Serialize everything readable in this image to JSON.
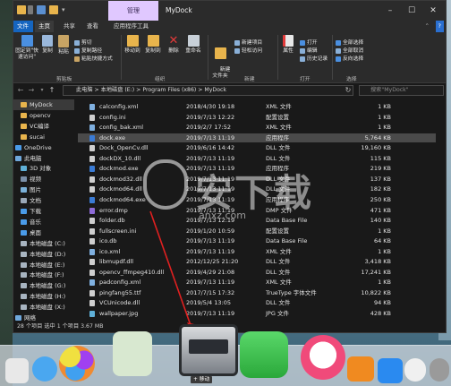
{
  "window": {
    "title": "MyDock",
    "context_tab": "管理",
    "controls": {
      "minimize": "–",
      "maximize": "☐",
      "close": "✕"
    }
  },
  "ribbon_tabs": [
    "文件",
    "主页",
    "共享",
    "查看",
    "应用程序工具"
  ],
  "ribbon": {
    "clipboard": {
      "pin": "固定到\"快速访问\"",
      "copy": "复制",
      "paste": "粘贴",
      "cut": "剪切",
      "copy_path": "复制路径",
      "paste_shortcut": "粘贴快捷方式",
      "label": "剪贴板"
    },
    "organize": {
      "move_to": "移动到",
      "copy_to": "复制到",
      "delete": "删除",
      "rename": "重命名",
      "label": "组织"
    },
    "new": {
      "new_folder": "新建\n文件夹",
      "new_item": "新建项目",
      "easy_access": "轻松访问",
      "label": "新建"
    },
    "open": {
      "properties": "属性",
      "open": "打开",
      "edit": "编辑",
      "history": "历史记录",
      "label": "打开"
    },
    "select": {
      "select_all": "全部选择",
      "select_none": "全部取消",
      "invert": "反向选择",
      "label": "选择"
    }
  },
  "address": {
    "path": "此电脑  >  本地磁盘 (E:)  >  Program Files (x86)  >  MyDock",
    "search_placeholder": "搜索\"MyDock\""
  },
  "nav_pane": [
    {
      "label": "MyDock",
      "color": "#e8b44c"
    },
    {
      "label": "opencv",
      "color": "#e8b44c"
    },
    {
      "label": "VC编译",
      "color": "#e8b44c"
    },
    {
      "label": "sucai",
      "color": "#e8b44c"
    },
    {
      "label": "OneDrive",
      "color": "#4a9be8"
    },
    {
      "label": "此电脑",
      "color": "#6fa8dc"
    },
    {
      "label": "3D 对象",
      "color": "#5fb0d8"
    },
    {
      "label": "视频",
      "color": "#7a8fa8"
    },
    {
      "label": "图片",
      "color": "#7ab0d8"
    },
    {
      "label": "文档",
      "color": "#9aa8b8"
    },
    {
      "label": "下载",
      "color": "#4a9be8"
    },
    {
      "label": "音乐",
      "color": "#4a9be8"
    },
    {
      "label": "桌面",
      "color": "#4a9be8"
    },
    {
      "label": "本地磁盘 (C:)",
      "color": "#a8b4c0"
    },
    {
      "label": "本地磁盘 (D:)",
      "color": "#a8b4c0"
    },
    {
      "label": "本地磁盘 (E:)",
      "color": "#a8b4c0"
    },
    {
      "label": "本地磁盘 (F:)",
      "color": "#a8b4c0"
    },
    {
      "label": "本地磁盘 (G:)",
      "color": "#a8b4c0"
    },
    {
      "label": "本地磁盘 (H:)",
      "color": "#a8b4c0"
    },
    {
      "label": "本地磁盘 (X:)",
      "color": "#a8b4c0"
    },
    {
      "label": "网络",
      "color": "#6fa8dc"
    }
  ],
  "files": [
    {
      "name": "calconfig.xml",
      "date": "2018/4/30 19:18",
      "type": "XML 文件",
      "size": "1 KB",
      "color": "#7fb0e0"
    },
    {
      "name": "config.ini",
      "date": "2019/7/13 12:22",
      "type": "配置设置",
      "size": "1 KB",
      "color": "#cfcfcf"
    },
    {
      "name": "config_bak.xml",
      "date": "2019/2/7 17:52",
      "type": "XML 文件",
      "size": "1 KB",
      "color": "#7fb0e0"
    },
    {
      "name": "dock.exe",
      "date": "2019/7/13 11:19",
      "type": "应用程序",
      "size": "5,764 KB",
      "color": "#3a7bd5"
    },
    {
      "name": "Dock_OpenCv.dll",
      "date": "2019/6/16 14:42",
      "type": "DLL 文件",
      "size": "19,160 KB",
      "color": "#cfcfcf"
    },
    {
      "name": "dockDX_10.dll",
      "date": "2019/7/13 11:19",
      "type": "DLL 文件",
      "size": "115 KB",
      "color": "#cfcfcf"
    },
    {
      "name": "dockmod.exe",
      "date": "2019/7/13 11:19",
      "type": "应用程序",
      "size": "219 KB",
      "color": "#3a7bd5"
    },
    {
      "name": "dockmod32.dll",
      "date": "2019/7/13 11:19",
      "type": "DLL 文件",
      "size": "137 KB",
      "color": "#cfcfcf"
    },
    {
      "name": "dockmod64.dll",
      "date": "2019/7/13 11:19",
      "type": "DLL 文件",
      "size": "182 KB",
      "color": "#cfcfcf"
    },
    {
      "name": "dockmod64.exe",
      "date": "2019/7/13 11:19",
      "type": "应用程序",
      "size": "250 KB",
      "color": "#3a7bd5"
    },
    {
      "name": "error.dmp",
      "date": "2019/7/13 11:19",
      "type": "DMP 文件",
      "size": "471 KB",
      "color": "#8e6bd8"
    },
    {
      "name": "folder.db",
      "date": "2019/7/13 12:19",
      "type": "Data Base File",
      "size": "140 KB",
      "color": "#cfcfcf"
    },
    {
      "name": "fullscreen.ini",
      "date": "2019/1/20 10:59",
      "type": "配置设置",
      "size": "1 KB",
      "color": "#cfcfcf"
    },
    {
      "name": "ico.db",
      "date": "2019/7/13 11:19",
      "type": "Data Base File",
      "size": "64 KB",
      "color": "#cfcfcf"
    },
    {
      "name": "ico.xml",
      "date": "2019/7/13 11:19",
      "type": "XML 文件",
      "size": "1 KB",
      "color": "#7fb0e0"
    },
    {
      "name": "libmupdf.dll",
      "date": "2012/12/25 21:20",
      "type": "DLL 文件",
      "size": "3,418 KB",
      "color": "#cfcfcf"
    },
    {
      "name": "opencv_ffmpeg410.dll",
      "date": "2019/4/29 21:08",
      "type": "DLL 文件",
      "size": "17,241 KB",
      "color": "#cfcfcf"
    },
    {
      "name": "padconfig.xml",
      "date": "2019/7/13 11:19",
      "type": "XML 文件",
      "size": "1 KB",
      "color": "#7fb0e0"
    },
    {
      "name": "pingfang55.ttf",
      "date": "2017/7/15 17:32",
      "type": "TrueType 字体文件",
      "size": "10,822 KB",
      "color": "#cfcfcf"
    },
    {
      "name": "VCUnicode.dll",
      "date": "2019/5/4 13:05",
      "type": "DLL 文件",
      "size": "94 KB",
      "color": "#cfcfcf"
    },
    {
      "name": "wallpaper.jpg",
      "date": "2019/7/13 11:19",
      "type": "JPG 文件",
      "size": "428 KB",
      "color": "#5fb0d8"
    }
  ],
  "status": "28 个项目    选中 1 个项目  3.67 MB",
  "watermark": {
    "text": "安下载",
    "url": "anxz.com"
  },
  "dock": {
    "drag_label": "+ 移动",
    "icons": [
      {
        "name": "photos",
        "color": "#e8e8e8"
      },
      {
        "name": "messages",
        "color": "#4aa7f0"
      },
      {
        "name": "game-center",
        "color": "#f0a030"
      },
      {
        "name": "maps",
        "color": "#d8e8d0"
      },
      {
        "name": "dock-settings",
        "color": "#8a8f96"
      },
      {
        "name": "facetime",
        "color": "#3ac24a"
      },
      {
        "name": "itunes",
        "color": "#f04a7a"
      },
      {
        "name": "ibooks",
        "color": "#f08a20"
      },
      {
        "name": "app-store",
        "color": "#2a8af0"
      },
      {
        "name": "photos-app",
        "color": "#f0f0f0"
      },
      {
        "name": "system-preferences",
        "color": "#9a9a9a"
      }
    ]
  }
}
